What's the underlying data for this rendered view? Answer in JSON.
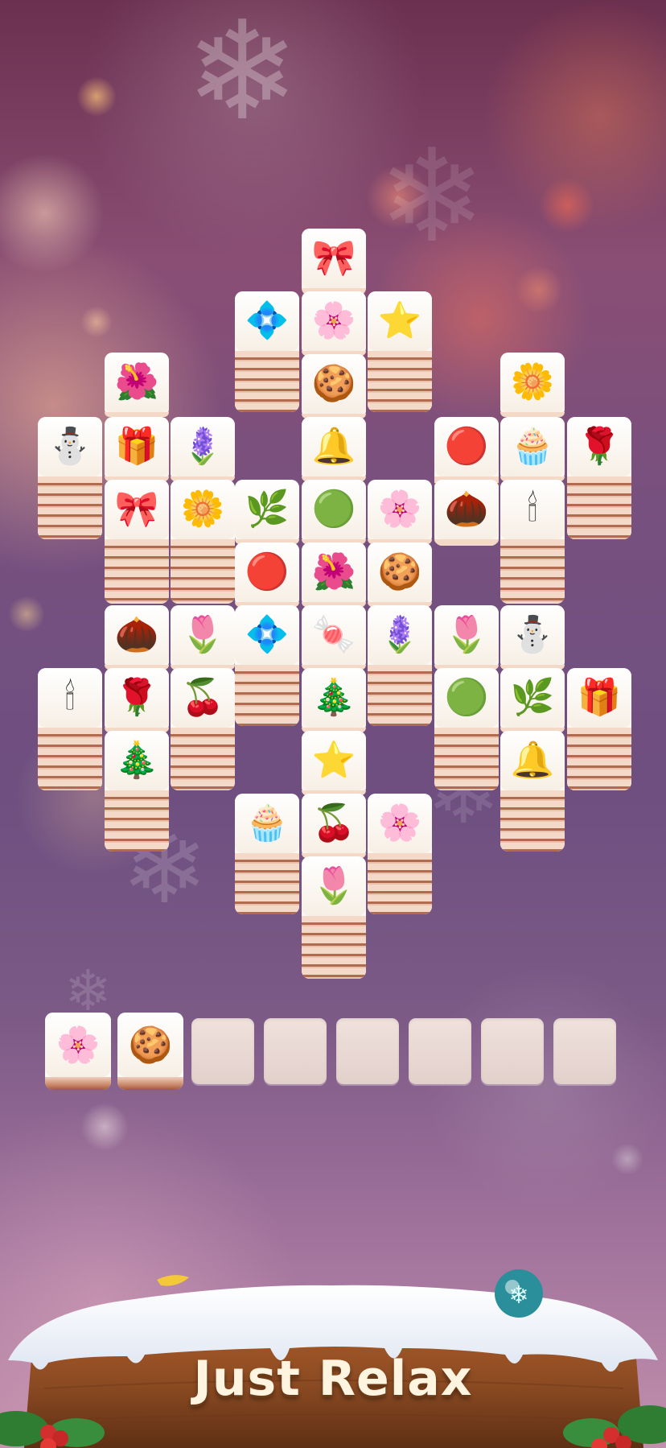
{
  "banner": {
    "title": "Just Relax"
  },
  "icons": {
    "bow": "🎀",
    "poinsettia": "🌺",
    "blue-poinsettia": "💠",
    "hellebore": "🌸",
    "star": "⭐",
    "berries-flower": "🌺",
    "gingerbread": "🍪",
    "white-flower": "🌼",
    "snowman": "⛄",
    "gift": "🎁",
    "lavender": "🪻",
    "bell": "🔔",
    "ornament": "🔴",
    "cupcake": "🧁",
    "rose": "🌹",
    "wreath": "🌿",
    "green-ornament": "🟢",
    "pansy": "🌸",
    "pinecone": "🌰",
    "candle": "🕯",
    "pink-poinsettia": "🌷",
    "candy-cane": "🍬",
    "holly": "🍒",
    "tree": "🎄"
  },
  "board": {
    "tiles": [
      {
        "icon": "bow"
      },
      {
        "icon": "blue-poinsettia"
      },
      {
        "icon": "hellebore"
      },
      {
        "icon": "star"
      },
      {
        "icon": "berries-flower"
      },
      {
        "icon": "gingerbread"
      },
      {
        "icon": "white-flower"
      },
      {
        "icon": "snowman"
      },
      {
        "icon": "gift"
      },
      {
        "icon": "lavender"
      },
      {
        "icon": "bell"
      },
      {
        "icon": "ornament"
      },
      {
        "icon": "cupcake"
      },
      {
        "icon": "rose"
      },
      {
        "icon": "bow"
      },
      {
        "icon": "white-flower"
      },
      {
        "icon": "wreath"
      },
      {
        "icon": "green-ornament"
      },
      {
        "icon": "pansy"
      },
      {
        "icon": "pinecone"
      },
      {
        "icon": "candle"
      },
      {
        "icon": "ornament"
      },
      {
        "icon": "berries-flower"
      },
      {
        "icon": "gingerbread"
      },
      {
        "icon": "pinecone"
      },
      {
        "icon": "pink-poinsettia"
      },
      {
        "icon": "blue-poinsettia"
      },
      {
        "icon": "candy-cane"
      },
      {
        "icon": "lavender"
      },
      {
        "icon": "pink-poinsettia"
      },
      {
        "icon": "snowman"
      },
      {
        "icon": "candle"
      },
      {
        "icon": "rose"
      },
      {
        "icon": "holly"
      },
      {
        "icon": "tree"
      },
      {
        "icon": "green-ornament"
      },
      {
        "icon": "wreath"
      },
      {
        "icon": "gift"
      },
      {
        "icon": "tree"
      },
      {
        "icon": "star"
      },
      {
        "icon": "bell"
      },
      {
        "icon": "cupcake"
      },
      {
        "icon": "holly"
      },
      {
        "icon": "hellebore"
      },
      {
        "icon": "pink-poinsettia"
      }
    ]
  },
  "tray": {
    "capacity": 8,
    "tiles": [
      {
        "icon": "pansy"
      },
      {
        "icon": "gingerbread"
      }
    ]
  },
  "colors": {
    "tile_face": "#fffdf9",
    "tile_edge": "#b06a4e",
    "banner_wood": "#8a4a22",
    "title": "#fff4e0"
  }
}
